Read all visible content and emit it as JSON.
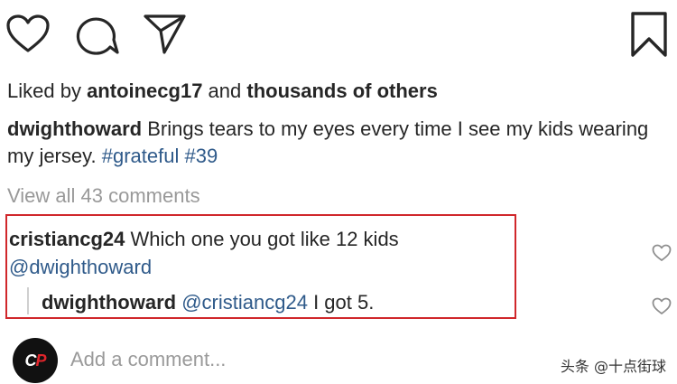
{
  "actions": {
    "like_icon": "heart-outline",
    "comment_icon": "comment-bubble",
    "share_icon": "paper-plane",
    "save_icon": "bookmark-outline"
  },
  "likes": {
    "prefix": "Liked by ",
    "user": "antoinecg17",
    "connector": " and ",
    "others": "thousands of others"
  },
  "caption": {
    "username": "dwighthoward",
    "text": " Brings tears to my eyes every time I see my kids wearing my jersey. ",
    "hashtag_1": "#grateful",
    "space": " ",
    "hashtag_2": "#39"
  },
  "view_all_comments": "View all 43 comments",
  "comments": [
    {
      "username": "cristiancg24",
      "text": " Which one you got like 12 kids",
      "mention": "@dwighthoward",
      "replies": [
        {
          "username": "dwighthoward",
          "space": " ",
          "mention": "@cristiancg24",
          "text": " I got 5."
        }
      ]
    }
  ],
  "highlight_color": "#d0272b",
  "add_comment_placeholder": "Add a comment...",
  "avatar_text": {
    "c": "C",
    "p": "P"
  },
  "watermark": "头条 @十点街球"
}
